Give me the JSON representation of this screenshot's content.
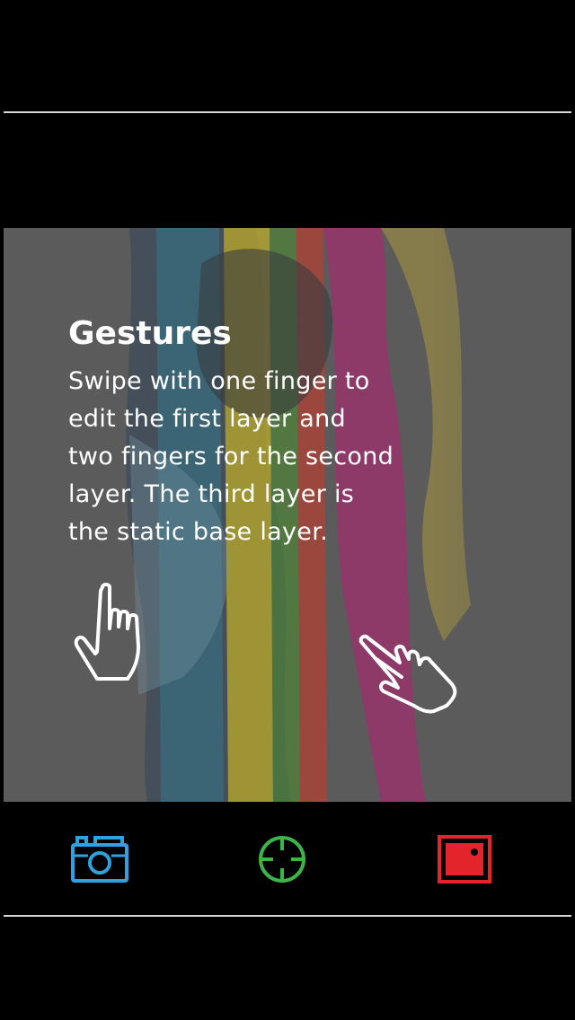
{
  "overlay": {
    "title": "Gestures",
    "body_lines": [
      "Swipe with one finger to",
      "edit the first layer and",
      "two fingers for the second",
      "layer. The third layer is",
      "the static base layer."
    ]
  },
  "gestures": {
    "one_finger": {
      "icon": "one-finger-hand-icon"
    },
    "two_fingers": {
      "icon": "two-finger-hand-icon"
    }
  },
  "toolbar": {
    "buttons": [
      {
        "icon": "camera-icon",
        "color": "#2ca3e0"
      },
      {
        "icon": "crosshair-icon",
        "color": "#39b54a"
      },
      {
        "icon": "frame-icon",
        "color": "#e4242b"
      }
    ]
  },
  "colors": {
    "background": "#000000",
    "canvas_gray": "#5b5b5b",
    "overlay_text": "#ffffff",
    "rules": "#d8d8d8"
  }
}
